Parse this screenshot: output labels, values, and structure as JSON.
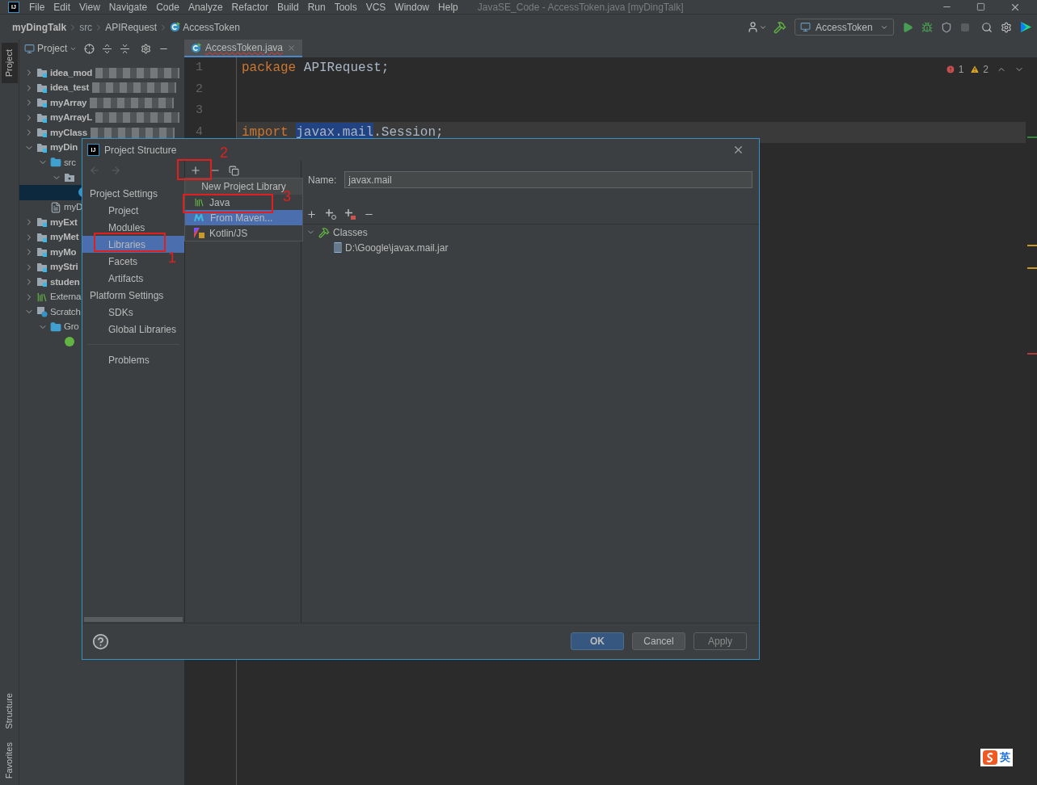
{
  "title_bar": {
    "logo": "IJ",
    "menu": [
      "File",
      "Edit",
      "View",
      "Navigate",
      "Code",
      "Analyze",
      "Refactor",
      "Build",
      "Run",
      "Tools",
      "VCS",
      "Window",
      "Help"
    ],
    "title": "JavaSE_Code - AccessToken.java [myDingTalk]"
  },
  "breadcrumbs": [
    {
      "label": "myDingTalk",
      "kind": "project"
    },
    {
      "label": "src",
      "kind": "folder"
    },
    {
      "label": "APIRequest",
      "kind": "package"
    },
    {
      "label": "AccessToken",
      "kind": "class"
    }
  ],
  "toolbar": {
    "run_config": "AccessToken",
    "stop_disabled": true
  },
  "tool_strip": {
    "top": [
      {
        "label": "Project",
        "selected": true
      }
    ],
    "bottom": [
      {
        "label": "Structure",
        "selected": false
      },
      {
        "label": "Favorites",
        "selected": false
      }
    ]
  },
  "project_panel": {
    "title": "Project",
    "tree": [
      {
        "label": "idea_mod",
        "kind": "module",
        "expanded": false,
        "selected": false,
        "redacted": true
      },
      {
        "label": "idea_test",
        "kind": "module",
        "expanded": false,
        "selected": false,
        "redacted": true
      },
      {
        "label": "myArray",
        "kind": "module",
        "expanded": false,
        "selected": false,
        "redacted": true
      },
      {
        "label": "myArrayL",
        "kind": "module",
        "expanded": false,
        "selected": false,
        "redacted": true
      },
      {
        "label": "myClass",
        "kind": "module",
        "expanded": false,
        "selected": false,
        "redacted": true
      },
      {
        "label": "myDin",
        "kind": "module",
        "expanded": true,
        "selected": false,
        "children": [
          {
            "label": "src",
            "kind": "folder",
            "expanded": true,
            "selected": false,
            "children": [
              {
                "kind": "package",
                "expanded": true,
                "selected": false,
                "children": [
                  {
                    "kind": "class",
                    "selected": true
                  }
                ]
              }
            ]
          },
          {
            "label": "myD",
            "kind": "file",
            "selected": false
          }
        ]
      },
      {
        "label": "myExt",
        "kind": "module",
        "expanded": false,
        "selected": false
      },
      {
        "label": "myMet",
        "kind": "module",
        "expanded": false,
        "selected": false
      },
      {
        "label": "myMo",
        "kind": "module",
        "expanded": false,
        "selected": false
      },
      {
        "label": "myStri",
        "kind": "module",
        "expanded": false,
        "selected": false
      },
      {
        "label": "studen",
        "kind": "module",
        "expanded": false,
        "selected": false
      },
      {
        "label": "Externa",
        "kind": "libraries",
        "expanded": false,
        "selected": false
      },
      {
        "label": "Scratch",
        "kind": "scratches",
        "expanded": true,
        "selected": false,
        "children": [
          {
            "label": "Gro",
            "kind": "folder",
            "expanded": true,
            "selected": false,
            "children": [
              {
                "kind": "groovy",
                "selected": false
              }
            ]
          }
        ]
      }
    ]
  },
  "editor": {
    "tabs": [
      {
        "label": "AccessToken.java",
        "selected": true
      }
    ],
    "lines": [
      {
        "number": "1",
        "tokens": [
          {
            "text": "package",
            "kind": "keyword"
          },
          {
            "text": "APIRequest",
            "kind": "plain"
          },
          {
            "text": ";",
            "kind": "punct"
          }
        ],
        "highlighted": false
      },
      {
        "number": "2",
        "highlighted": false
      },
      {
        "number": "3",
        "highlighted": false
      },
      {
        "number": "4",
        "tokens": [
          {
            "text": "import",
            "kind": "keyword"
          },
          {
            "text": "javax.mail",
            "kind": "selected"
          },
          {
            "text": ".Session",
            "kind": "member"
          },
          {
            "text": ";",
            "kind": "punct"
          }
        ],
        "highlighted": true
      }
    ],
    "errors": "1",
    "warnings": "2",
    "stripe_marks": [
      {
        "color": "#2f8a3a"
      },
      {
        "color": "#c79a28"
      },
      {
        "color": "#c79a28"
      },
      {
        "color": "#b33a3a"
      }
    ]
  },
  "dialog": {
    "logo": "IJ",
    "title": "Project Structure",
    "nav": [
      {
        "label": "Project Settings",
        "kind": "header"
      },
      {
        "label": "Project",
        "kind": "item",
        "selected": false
      },
      {
        "label": "Modules",
        "kind": "item",
        "selected": false
      },
      {
        "label": "Libraries",
        "kind": "item",
        "selected": true
      },
      {
        "label": "Facets",
        "kind": "item",
        "selected": false
      },
      {
        "label": "Artifacts",
        "kind": "item",
        "selected": false
      },
      {
        "label": "Platform Settings",
        "kind": "header"
      },
      {
        "label": "SDKs",
        "kind": "item",
        "selected": false
      },
      {
        "label": "Global Libraries",
        "kind": "item",
        "selected": false
      },
      {
        "kind": "divider"
      },
      {
        "label": "Problems",
        "kind": "item",
        "selected": false
      }
    ],
    "popup": {
      "title": "New Project Library",
      "items": [
        {
          "label": "Java",
          "kind": "java",
          "selected": false
        },
        {
          "label": "From Maven...",
          "kind": "maven",
          "selected": true
        },
        {
          "label": "Kotlin/JS",
          "kind": "kotlin",
          "selected": false
        }
      ]
    },
    "name_label": "Name:",
    "name_value": "javax.mail",
    "roots": [
      {
        "label": "Classes",
        "expanded": true,
        "children": [
          {
            "label": "D:\\Google\\javax.mail.jar"
          }
        ]
      }
    ],
    "buttons": [
      {
        "label": "OK",
        "kind": "default",
        "disabled": false
      },
      {
        "label": "Cancel",
        "kind": "normal",
        "disabled": false
      },
      {
        "label": "Apply",
        "kind": "normal",
        "disabled": true
      }
    ],
    "annotations": [
      {
        "label": "1"
      },
      {
        "label": "2"
      },
      {
        "label": "3"
      }
    ]
  },
  "ime": {
    "label": "英"
  }
}
